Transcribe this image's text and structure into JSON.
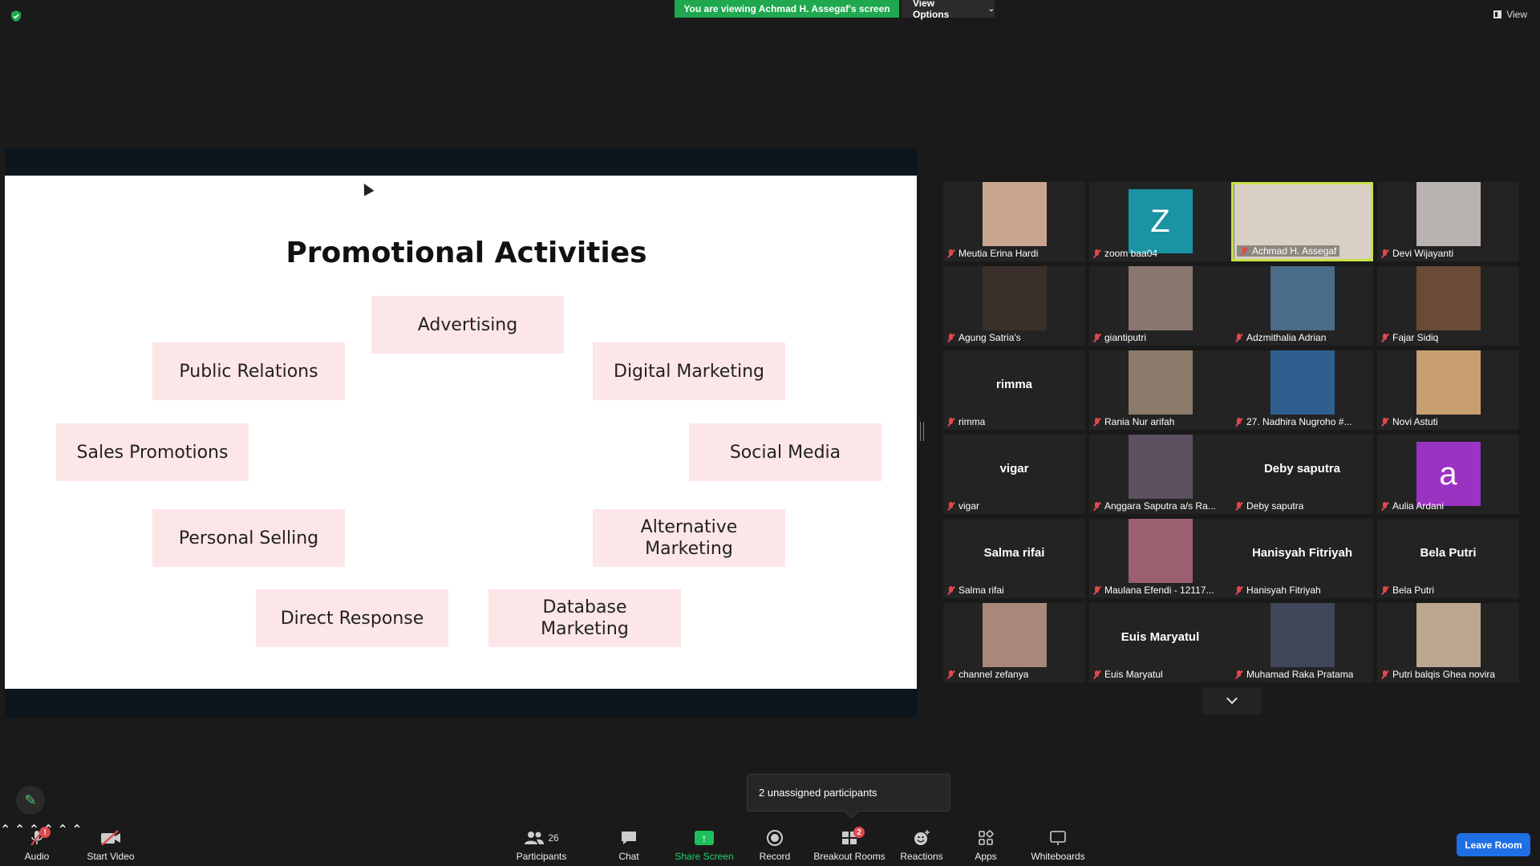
{
  "top": {
    "banner": "You are viewing Achmad H. Assegaf's screen",
    "view_options": "View Options",
    "view": "View"
  },
  "slide": {
    "title": "Promotional Activities",
    "boxes": {
      "advertising": "Advertising",
      "public_relations": "Public Relations",
      "digital_marketing": "Digital Marketing",
      "sales_promotions": "Sales Promotions",
      "social_media": "Social Media",
      "personal_selling": "Personal Selling",
      "alternative_marketing": "Alternative Marketing",
      "direct_response": "Direct Response",
      "database_marketing": "Database Marketing"
    }
  },
  "participants": [
    {
      "name": "Meutia Erina Hardi",
      "kind": "photo",
      "color": "#c9a58f"
    },
    {
      "name": "zoom baa04",
      "kind": "letter",
      "letter": "Z",
      "color": "#1a93a3"
    },
    {
      "name": "Achmad H. Assegaf",
      "kind": "photo",
      "color": "#d9cfc4",
      "active": true
    },
    {
      "name": "Devi Wijayanti",
      "kind": "photo",
      "color": "#b8b3b0"
    },
    {
      "name": "Agung Satria's",
      "kind": "photo",
      "color": "#3a2f2a"
    },
    {
      "name": "giantiputri",
      "kind": "photo",
      "color": "#8a7770"
    },
    {
      "name": "Adzmithalia Adrian",
      "kind": "photo",
      "color": "#4a6c88"
    },
    {
      "name": "Fajar Sidiq",
      "kind": "photo",
      "color": "#6b4a38"
    },
    {
      "name": "rimma",
      "kind": "name",
      "display": "rimma"
    },
    {
      "name": "Rania Nur arifah",
      "kind": "photo",
      "color": "#8c7a6a"
    },
    {
      "name": "27. Nadhira Nugroho #...",
      "kind": "photo",
      "color": "#2f5f8f"
    },
    {
      "name": "Novi Astuti",
      "kind": "photo",
      "color": "#c8a070"
    },
    {
      "name": "vigar",
      "kind": "name",
      "display": "vigar"
    },
    {
      "name": "Anggara Saputra a/s Ra...",
      "kind": "photo",
      "color": "#5d5060"
    },
    {
      "name": "Deby saputra",
      "kind": "name",
      "display": "Deby saputra"
    },
    {
      "name": "Aulia Ardani",
      "kind": "letter",
      "letter": "a",
      "color": "#9b33c2"
    },
    {
      "name": "Salma rifai",
      "kind": "name",
      "display": "Salma rifai"
    },
    {
      "name": "Maulana Efendi - 12117...",
      "kind": "photo",
      "color": "#9a6070"
    },
    {
      "name": "Hanisyah Fitriyah",
      "kind": "name",
      "display": "Hanisyah Fitriyah"
    },
    {
      "name": "Bela Putri",
      "kind": "name",
      "display": "Bela Putri"
    },
    {
      "name": "channel zefanya",
      "kind": "photo",
      "color": "#a88878"
    },
    {
      "name": "Euis Maryatul",
      "kind": "name",
      "display": "Euis Maryatul"
    },
    {
      "name": "Muhamad Raka Pratama",
      "kind": "photo",
      "color": "#3f4658"
    },
    {
      "name": "Putri balqis Ghea novira",
      "kind": "photo",
      "color": "#bba690"
    }
  ],
  "tooltip": "2 unassigned participants",
  "toolbar": {
    "audio": "Audio",
    "audio_badge": "!",
    "start_video": "Start Video",
    "participants": "Participants",
    "participants_count": "26",
    "chat": "Chat",
    "share_screen": "Share Screen",
    "record": "Record",
    "breakout_rooms": "Breakout Rooms",
    "breakout_badge": "2",
    "reactions": "Reactions",
    "apps": "Apps",
    "whiteboards": "Whiteboards",
    "leave_room": "Leave Room"
  },
  "colors": {
    "accent_green": "#1fa84f",
    "leave_blue": "#1f6fe5",
    "slide_box": "#fde6e8",
    "active_speaker": "#c6e14a",
    "mute_red": "#e0474c"
  }
}
